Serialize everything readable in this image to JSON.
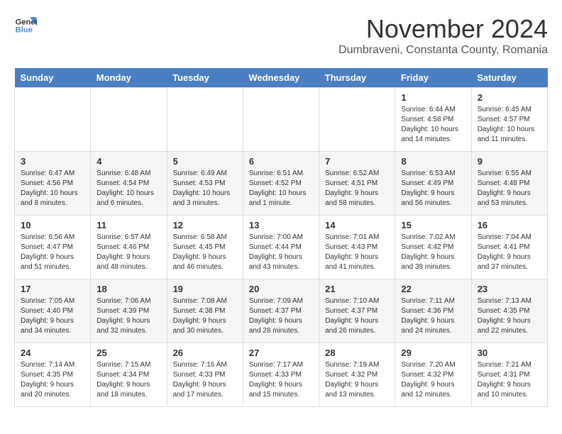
{
  "logo": {
    "text_general": "General",
    "text_blue": "Blue"
  },
  "title": "November 2024",
  "subtitle": "Dumbraveni, Constanta County, Romania",
  "days_of_week": [
    "Sunday",
    "Monday",
    "Tuesday",
    "Wednesday",
    "Thursday",
    "Friday",
    "Saturday"
  ],
  "weeks": [
    [
      {
        "day": "",
        "info": ""
      },
      {
        "day": "",
        "info": ""
      },
      {
        "day": "",
        "info": ""
      },
      {
        "day": "",
        "info": ""
      },
      {
        "day": "",
        "info": ""
      },
      {
        "day": "1",
        "info": "Sunrise: 6:44 AM\nSunset: 4:58 PM\nDaylight: 10 hours and 14 minutes."
      },
      {
        "day": "2",
        "info": "Sunrise: 6:45 AM\nSunset: 4:57 PM\nDaylight: 10 hours and 11 minutes."
      }
    ],
    [
      {
        "day": "3",
        "info": "Sunrise: 6:47 AM\nSunset: 4:56 PM\nDaylight: 10 hours and 8 minutes."
      },
      {
        "day": "4",
        "info": "Sunrise: 6:48 AM\nSunset: 4:54 PM\nDaylight: 10 hours and 6 minutes."
      },
      {
        "day": "5",
        "info": "Sunrise: 6:49 AM\nSunset: 4:53 PM\nDaylight: 10 hours and 3 minutes."
      },
      {
        "day": "6",
        "info": "Sunrise: 6:51 AM\nSunset: 4:52 PM\nDaylight: 10 hours and 1 minute."
      },
      {
        "day": "7",
        "info": "Sunrise: 6:52 AM\nSunset: 4:51 PM\nDaylight: 9 hours and 58 minutes."
      },
      {
        "day": "8",
        "info": "Sunrise: 6:53 AM\nSunset: 4:49 PM\nDaylight: 9 hours and 56 minutes."
      },
      {
        "day": "9",
        "info": "Sunrise: 6:55 AM\nSunset: 4:48 PM\nDaylight: 9 hours and 53 minutes."
      }
    ],
    [
      {
        "day": "10",
        "info": "Sunrise: 6:56 AM\nSunset: 4:47 PM\nDaylight: 9 hours and 51 minutes."
      },
      {
        "day": "11",
        "info": "Sunrise: 6:57 AM\nSunset: 4:46 PM\nDaylight: 9 hours and 48 minutes."
      },
      {
        "day": "12",
        "info": "Sunrise: 6:58 AM\nSunset: 4:45 PM\nDaylight: 9 hours and 46 minutes."
      },
      {
        "day": "13",
        "info": "Sunrise: 7:00 AM\nSunset: 4:44 PM\nDaylight: 9 hours and 43 minutes."
      },
      {
        "day": "14",
        "info": "Sunrise: 7:01 AM\nSunset: 4:43 PM\nDaylight: 9 hours and 41 minutes."
      },
      {
        "day": "15",
        "info": "Sunrise: 7:02 AM\nSunset: 4:42 PM\nDaylight: 9 hours and 39 minutes."
      },
      {
        "day": "16",
        "info": "Sunrise: 7:04 AM\nSunset: 4:41 PM\nDaylight: 9 hours and 37 minutes."
      }
    ],
    [
      {
        "day": "17",
        "info": "Sunrise: 7:05 AM\nSunset: 4:40 PM\nDaylight: 9 hours and 34 minutes."
      },
      {
        "day": "18",
        "info": "Sunrise: 7:06 AM\nSunset: 4:39 PM\nDaylight: 9 hours and 32 minutes."
      },
      {
        "day": "19",
        "info": "Sunrise: 7:08 AM\nSunset: 4:38 PM\nDaylight: 9 hours and 30 minutes."
      },
      {
        "day": "20",
        "info": "Sunrise: 7:09 AM\nSunset: 4:37 PM\nDaylight: 9 hours and 28 minutes."
      },
      {
        "day": "21",
        "info": "Sunrise: 7:10 AM\nSunset: 4:37 PM\nDaylight: 9 hours and 26 minutes."
      },
      {
        "day": "22",
        "info": "Sunrise: 7:11 AM\nSunset: 4:36 PM\nDaylight: 9 hours and 24 minutes."
      },
      {
        "day": "23",
        "info": "Sunrise: 7:13 AM\nSunset: 4:35 PM\nDaylight: 9 hours and 22 minutes."
      }
    ],
    [
      {
        "day": "24",
        "info": "Sunrise: 7:14 AM\nSunset: 4:35 PM\nDaylight: 9 hours and 20 minutes."
      },
      {
        "day": "25",
        "info": "Sunrise: 7:15 AM\nSunset: 4:34 PM\nDaylight: 9 hours and 18 minutes."
      },
      {
        "day": "26",
        "info": "Sunrise: 7:16 AM\nSunset: 4:33 PM\nDaylight: 9 hours and 17 minutes."
      },
      {
        "day": "27",
        "info": "Sunrise: 7:17 AM\nSunset: 4:33 PM\nDaylight: 9 hours and 15 minutes."
      },
      {
        "day": "28",
        "info": "Sunrise: 7:19 AM\nSunset: 4:32 PM\nDaylight: 9 hours and 13 minutes."
      },
      {
        "day": "29",
        "info": "Sunrise: 7:20 AM\nSunset: 4:32 PM\nDaylight: 9 hours and 12 minutes."
      },
      {
        "day": "30",
        "info": "Sunrise: 7:21 AM\nSunset: 4:31 PM\nDaylight: 9 hours and 10 minutes."
      }
    ]
  ]
}
